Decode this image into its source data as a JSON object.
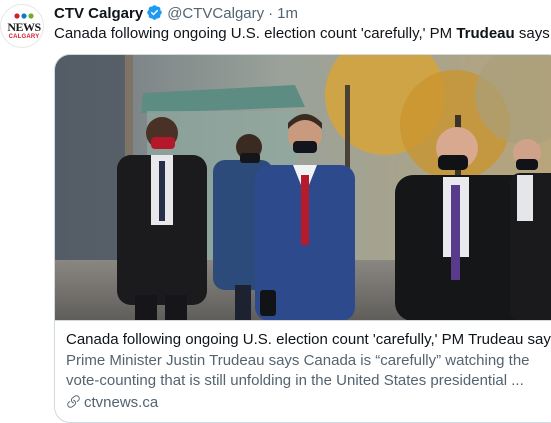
{
  "author": {
    "display_name": "CTV Calgary",
    "handle": "@CTVCalgary",
    "separator": "·",
    "time": "1m",
    "avatar": {
      "brand": "ctv-news-logo",
      "logo_text": "NEWS",
      "city_text": "CALGARY"
    }
  },
  "tweet": {
    "text_before": "Canada following ongoing U.S. election count 'carefully,' PM ",
    "text_bold": "Trudeau",
    "text_after": " says:"
  },
  "card": {
    "image": "photo-trudeau-walking-masked-with-staff",
    "title": "Canada following ongoing U.S. election count 'carefully,' PM Trudeau says",
    "description_line1": "Prime Minister Justin Trudeau says Canada is “carefully” watching the",
    "description_line2": "vote-counting that is still unfolding in the United States presidential ...",
    "domain": "ctvnews.ca"
  },
  "colors": {
    "text_primary": "#0f1419",
    "text_secondary": "#536471",
    "verified_blue": "#1d9bf0",
    "card_border": "#cfd9de",
    "ctv_red": "#d1202f"
  }
}
